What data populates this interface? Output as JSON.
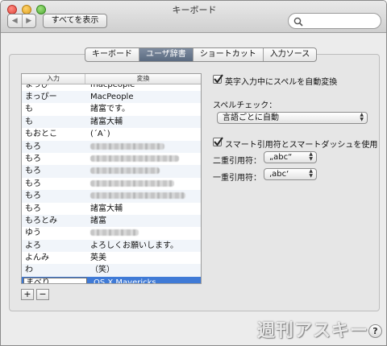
{
  "window": {
    "title": "キーボード"
  },
  "toolbar": {
    "back_glyph": "◀",
    "forward_glyph": "▶",
    "show_all_label": "すべてを表示",
    "search_placeholder": ""
  },
  "tabs": [
    {
      "label": "キーボード",
      "active": false
    },
    {
      "label": "ユーザ辞書",
      "active": true
    },
    {
      "label": "ショートカット",
      "active": false
    },
    {
      "label": "入力ソース",
      "active": false
    }
  ],
  "table": {
    "headers": {
      "input": "入力",
      "replace": "変換"
    },
    "rows": [
      {
        "input": "まっぴー",
        "replace": "macpeople",
        "blurred": false
      },
      {
        "input": "まっぴー",
        "replace": "MacPeople",
        "blurred": false
      },
      {
        "input": "も",
        "replace": "諸富です。",
        "blurred": false
      },
      {
        "input": "も",
        "replace": "諸富大輔",
        "blurred": false
      },
      {
        "input": "もおとこ",
        "replace": "(´A`)",
        "blurred": false
      },
      {
        "input": "もろ",
        "replace": "",
        "blurred": true
      },
      {
        "input": "もろ",
        "replace": "",
        "blurred": true
      },
      {
        "input": "もろ",
        "replace": "",
        "blurred": true
      },
      {
        "input": "もろ",
        "replace": "",
        "blurred": true
      },
      {
        "input": "もろ",
        "replace": "",
        "blurred": true
      },
      {
        "input": "もろ",
        "replace": "諸富大輔",
        "blurred": false
      },
      {
        "input": "もろとみ",
        "replace": "諸富",
        "blurred": false
      },
      {
        "input": "ゆう",
        "replace": "",
        "blurred": true
      },
      {
        "input": "よろ",
        "replace": "よろしくお願いします。",
        "blurred": false
      },
      {
        "input": "よんみ",
        "replace": "英美",
        "blurred": false
      },
      {
        "input": "わ",
        "replace": "（笑）",
        "blurred": false
      },
      {
        "input": "まべり",
        "replace": "OS X Mavericks",
        "blurred": false,
        "selected": true
      }
    ],
    "add_label": "+",
    "remove_label": "−"
  },
  "options": {
    "auto_spell": {
      "label": "英字入力中にスペルを自動変換",
      "checked": true
    },
    "spell_check_label": "スペルチェック：",
    "spell_check_value": "言語ごとに自動",
    "smart_quotes": {
      "label": "スマート引用符とスマートダッシュを使用",
      "checked": true
    },
    "double_quote_label": "二重引用符：",
    "double_quote_value": "„abc“",
    "single_quote_label": "一重引用符：",
    "single_quote_value": "‚abc‘"
  },
  "watermark": "週刊アスキー",
  "help_label": "?"
}
